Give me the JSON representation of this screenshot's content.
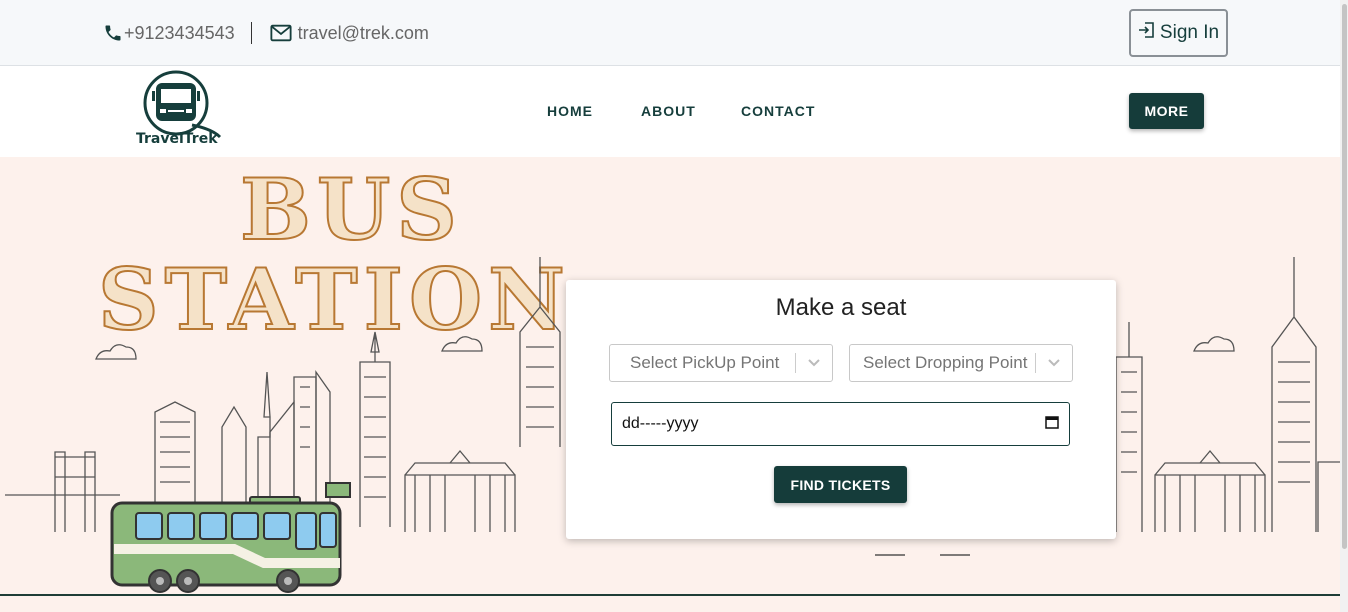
{
  "topbar": {
    "phone_icon": "phone-icon",
    "phone": "+9123434543",
    "mail_icon": "mail-icon",
    "email": "travel@trek.com",
    "signin_icon": "sign-in-icon",
    "signin_label": "Sign In"
  },
  "navbar": {
    "logo_text": "TravelTrek",
    "links": [
      "HOME",
      "ABOUT",
      "CONTACT"
    ],
    "more_label": "MORE",
    "accent": "#153c3a"
  },
  "hero": {
    "title_line1": "BUS",
    "title_line2": "STATION",
    "background": "#fdf1ec",
    "bus_color": "#8bb87a"
  },
  "booking": {
    "heading": "Make a seat",
    "pickup_placeholder": "Select PickUp Point",
    "drop_placeholder": "Select Dropping Point",
    "date_placeholder": "dd-----yyyy",
    "find_label": "FIND TICKETS"
  }
}
